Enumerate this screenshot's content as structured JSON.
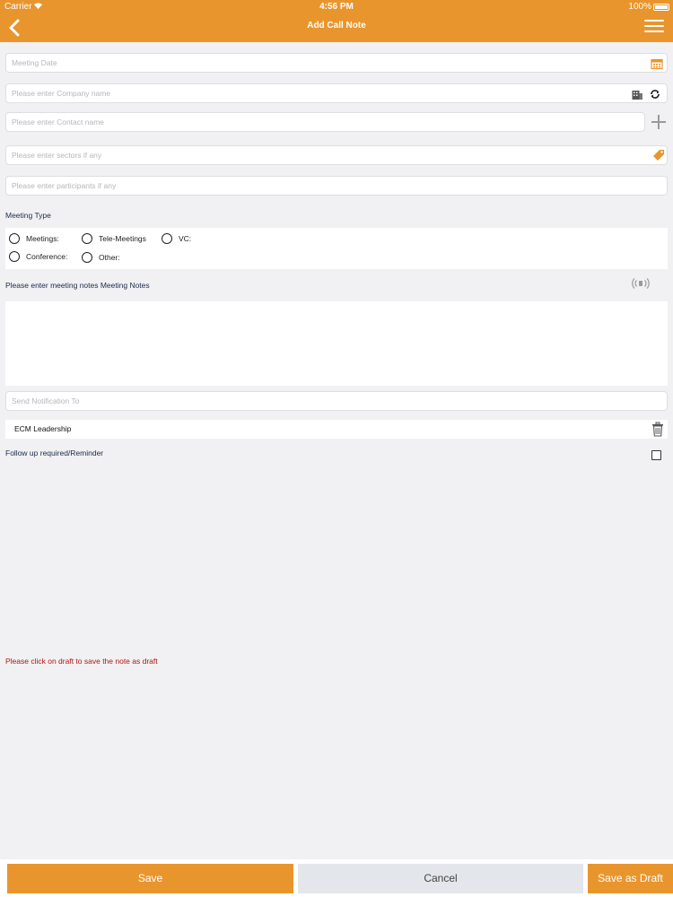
{
  "status_bar": {
    "carrier": "Carrier",
    "time": "4:56 PM",
    "battery": "100%"
  },
  "nav": {
    "title": "Add Call Note"
  },
  "colors": {
    "accent": "#e9952d",
    "error_text": "#b41414"
  },
  "form": {
    "meeting_date": {
      "placeholder": "Meeting Date",
      "icon": "calendar-icon"
    },
    "company": {
      "placeholder": "Please enter Company name",
      "icons": [
        "building-icon",
        "refresh-icon"
      ]
    },
    "contact": {
      "placeholder": "Please enter Contact name",
      "icon": "plus-icon"
    },
    "sectors": {
      "placeholder": "Please enter sectors if any",
      "icon": "tag-icon"
    },
    "participants": {
      "placeholder": "Please enter participants if any"
    },
    "meeting_type": {
      "label": "Meeting Type",
      "options": [
        "Meetings:",
        "Tele-Meetings",
        "VC:",
        "Conference:",
        "Other:"
      ]
    },
    "notes": {
      "label": "Please enter meeting notes Meeting Notes",
      "icon": "voice-input-icon"
    },
    "notify": {
      "placeholder": "Send Notification To"
    },
    "recipients": [
      "ECM Leadership"
    ],
    "follow_up": {
      "label": "Follow up required/Reminder",
      "checked": false
    }
  },
  "draft_message": "Please click on draft to save the note as draft",
  "buttons": {
    "save": "Save",
    "cancel": "Cancel",
    "save_draft": "Save as Draft"
  }
}
